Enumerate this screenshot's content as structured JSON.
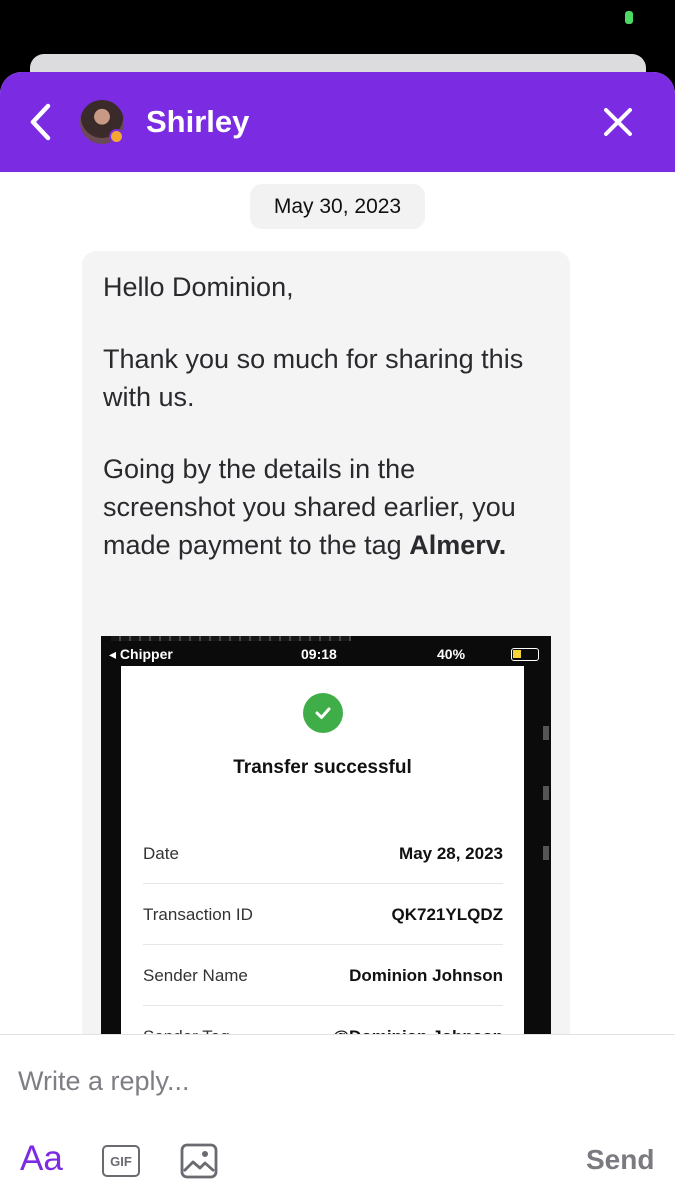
{
  "header": {
    "agent_name": "Shirley",
    "back_icon": "chevron-left-icon",
    "close_icon": "close-icon",
    "accent_color": "#7b2be2",
    "status_color": "#f3a833"
  },
  "conversation": {
    "date": "May 30, 2023",
    "message": {
      "greeting": "Hello Dominion,",
      "thanks": "Thank you so much for sharing this with us.",
      "details": "Going by the details in the screenshot you shared earlier, you made payment to the tag",
      "tag": "Almerv."
    },
    "attachment": {
      "carrier": "◂ Chipper",
      "time": "09:18",
      "battery": "40%",
      "title": "Transfer successful",
      "rows": [
        {
          "label": "Date",
          "value": "May 28, 2023"
        },
        {
          "label": "Transaction ID",
          "value": "QK721YLQDZ"
        },
        {
          "label": "Sender Name",
          "value": "Dominion Johnson"
        },
        {
          "label": "Sender Tag",
          "value": "@Dominion Johnson"
        }
      ]
    }
  },
  "composer": {
    "placeholder": "Write a reply...",
    "format_label": "Aa",
    "gif_label": "GIF",
    "send_label": "Send"
  }
}
